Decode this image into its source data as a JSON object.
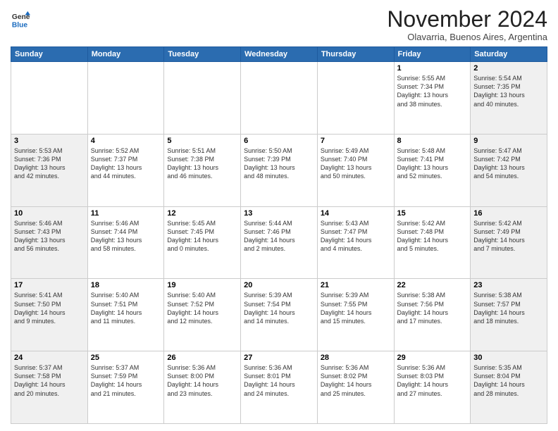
{
  "header": {
    "logo_line1": "General",
    "logo_line2": "Blue",
    "month": "November 2024",
    "location": "Olavarria, Buenos Aires, Argentina"
  },
  "weekdays": [
    "Sunday",
    "Monday",
    "Tuesday",
    "Wednesday",
    "Thursday",
    "Friday",
    "Saturday"
  ],
  "weeks": [
    [
      {
        "day": "",
        "info": ""
      },
      {
        "day": "",
        "info": ""
      },
      {
        "day": "",
        "info": ""
      },
      {
        "day": "",
        "info": ""
      },
      {
        "day": "",
        "info": ""
      },
      {
        "day": "1",
        "info": "Sunrise: 5:55 AM\nSunset: 7:34 PM\nDaylight: 13 hours\nand 38 minutes."
      },
      {
        "day": "2",
        "info": "Sunrise: 5:54 AM\nSunset: 7:35 PM\nDaylight: 13 hours\nand 40 minutes."
      }
    ],
    [
      {
        "day": "3",
        "info": "Sunrise: 5:53 AM\nSunset: 7:36 PM\nDaylight: 13 hours\nand 42 minutes."
      },
      {
        "day": "4",
        "info": "Sunrise: 5:52 AM\nSunset: 7:37 PM\nDaylight: 13 hours\nand 44 minutes."
      },
      {
        "day": "5",
        "info": "Sunrise: 5:51 AM\nSunset: 7:38 PM\nDaylight: 13 hours\nand 46 minutes."
      },
      {
        "day": "6",
        "info": "Sunrise: 5:50 AM\nSunset: 7:39 PM\nDaylight: 13 hours\nand 48 minutes."
      },
      {
        "day": "7",
        "info": "Sunrise: 5:49 AM\nSunset: 7:40 PM\nDaylight: 13 hours\nand 50 minutes."
      },
      {
        "day": "8",
        "info": "Sunrise: 5:48 AM\nSunset: 7:41 PM\nDaylight: 13 hours\nand 52 minutes."
      },
      {
        "day": "9",
        "info": "Sunrise: 5:47 AM\nSunset: 7:42 PM\nDaylight: 13 hours\nand 54 minutes."
      }
    ],
    [
      {
        "day": "10",
        "info": "Sunrise: 5:46 AM\nSunset: 7:43 PM\nDaylight: 13 hours\nand 56 minutes."
      },
      {
        "day": "11",
        "info": "Sunrise: 5:46 AM\nSunset: 7:44 PM\nDaylight: 13 hours\nand 58 minutes."
      },
      {
        "day": "12",
        "info": "Sunrise: 5:45 AM\nSunset: 7:45 PM\nDaylight: 14 hours\nand 0 minutes."
      },
      {
        "day": "13",
        "info": "Sunrise: 5:44 AM\nSunset: 7:46 PM\nDaylight: 14 hours\nand 2 minutes."
      },
      {
        "day": "14",
        "info": "Sunrise: 5:43 AM\nSunset: 7:47 PM\nDaylight: 14 hours\nand 4 minutes."
      },
      {
        "day": "15",
        "info": "Sunrise: 5:42 AM\nSunset: 7:48 PM\nDaylight: 14 hours\nand 5 minutes."
      },
      {
        "day": "16",
        "info": "Sunrise: 5:42 AM\nSunset: 7:49 PM\nDaylight: 14 hours\nand 7 minutes."
      }
    ],
    [
      {
        "day": "17",
        "info": "Sunrise: 5:41 AM\nSunset: 7:50 PM\nDaylight: 14 hours\nand 9 minutes."
      },
      {
        "day": "18",
        "info": "Sunrise: 5:40 AM\nSunset: 7:51 PM\nDaylight: 14 hours\nand 11 minutes."
      },
      {
        "day": "19",
        "info": "Sunrise: 5:40 AM\nSunset: 7:52 PM\nDaylight: 14 hours\nand 12 minutes."
      },
      {
        "day": "20",
        "info": "Sunrise: 5:39 AM\nSunset: 7:54 PM\nDaylight: 14 hours\nand 14 minutes."
      },
      {
        "day": "21",
        "info": "Sunrise: 5:39 AM\nSunset: 7:55 PM\nDaylight: 14 hours\nand 15 minutes."
      },
      {
        "day": "22",
        "info": "Sunrise: 5:38 AM\nSunset: 7:56 PM\nDaylight: 14 hours\nand 17 minutes."
      },
      {
        "day": "23",
        "info": "Sunrise: 5:38 AM\nSunset: 7:57 PM\nDaylight: 14 hours\nand 18 minutes."
      }
    ],
    [
      {
        "day": "24",
        "info": "Sunrise: 5:37 AM\nSunset: 7:58 PM\nDaylight: 14 hours\nand 20 minutes."
      },
      {
        "day": "25",
        "info": "Sunrise: 5:37 AM\nSunset: 7:59 PM\nDaylight: 14 hours\nand 21 minutes."
      },
      {
        "day": "26",
        "info": "Sunrise: 5:36 AM\nSunset: 8:00 PM\nDaylight: 14 hours\nand 23 minutes."
      },
      {
        "day": "27",
        "info": "Sunrise: 5:36 AM\nSunset: 8:01 PM\nDaylight: 14 hours\nand 24 minutes."
      },
      {
        "day": "28",
        "info": "Sunrise: 5:36 AM\nSunset: 8:02 PM\nDaylight: 14 hours\nand 25 minutes."
      },
      {
        "day": "29",
        "info": "Sunrise: 5:36 AM\nSunset: 8:03 PM\nDaylight: 14 hours\nand 27 minutes."
      },
      {
        "day": "30",
        "info": "Sunrise: 5:35 AM\nSunset: 8:04 PM\nDaylight: 14 hours\nand 28 minutes."
      }
    ]
  ]
}
